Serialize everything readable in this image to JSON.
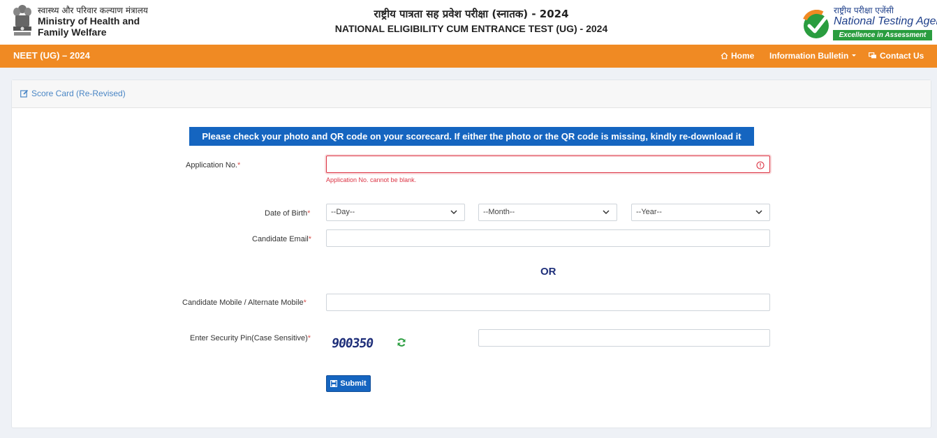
{
  "header": {
    "ministry_hi": "स्वास्थ्य और परिवार कल्याण मंत्रालय",
    "ministry_en_line1": "Ministry of Health and",
    "ministry_en_line2": "Family Welfare",
    "title_hi": "राष्ट्रीय पात्रता सह प्रवेश परीक्षा (स्नातक) - 2024",
    "title_en": "NATIONAL ELIGIBILITY CUM ENTRANCE TEST (UG) - 2024",
    "agency_hi": "राष्ट्रीय परीक्षा एजेंसी",
    "agency_en": "National Testing Agency",
    "agency_tagline": "Excellence in Assessment"
  },
  "navbar": {
    "brand": "NEET (UG) – 2024",
    "home": "Home",
    "info_bulletin": "Information Bulletin",
    "contact": "Contact Us"
  },
  "card": {
    "title": "Score Card (Re-Revised)",
    "notice": "Please check your photo and QR code on your scorecard. If either the photo or the QR code is missing, kindly re-download it"
  },
  "form": {
    "application_label": "Application No.",
    "application_value": "",
    "application_error": "Application No. cannot be blank.",
    "dob_label": "Date of Birth",
    "day_value": "--Day--",
    "month_value": "--Month--",
    "year_value": "--Year--",
    "email_label": "Candidate Email",
    "email_value": "",
    "or_text": "OR",
    "mobile_label": "Candidate Mobile / Alternate Mobile",
    "mobile_value": "",
    "pin_label": "Enter Security Pin(Case Sensitive)",
    "captcha_text": "900350",
    "pin_value": "",
    "required_mark": "*",
    "submit_label": "Submit"
  },
  "colors": {
    "navbar": "#f08a23",
    "primary": "#1565c0",
    "error": "#dc3545",
    "agency_blue": "#1e3f8a",
    "agency_green": "#2a9d3f"
  }
}
